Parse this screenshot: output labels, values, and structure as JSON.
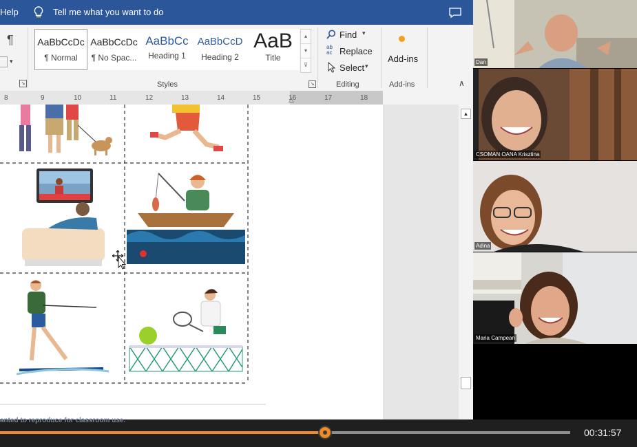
{
  "menu": {
    "help_label": "Help",
    "tell_me_placeholder": "Tell me what you want to do"
  },
  "ribbon": {
    "paragraph_mark": "¶",
    "styles": [
      {
        "sample": "AaBbCcDc",
        "name": "¶ Normal",
        "color": "#222222"
      },
      {
        "sample": "AaBbCcDc",
        "name": "¶ No Spac...",
        "color": "#222222"
      },
      {
        "sample": "AaBbCc",
        "name": "Heading 1",
        "color": "#2e5a9c"
      },
      {
        "sample": "AaBbCcD",
        "name": "Heading 2",
        "color": "#2e5a9c"
      },
      {
        "sample": "AaB",
        "name": "Title",
        "color": "#111111"
      }
    ],
    "styles_group_label": "Styles",
    "editing": {
      "find": "Find",
      "replace": "Replace",
      "select": "Select",
      "group_label": "Editing"
    },
    "addins": {
      "button_label": "Add-ins",
      "group_label": "Add-ins"
    }
  },
  "ruler": {
    "ticks": [
      "8",
      "9",
      "10",
      "11",
      "12",
      "13",
      "14",
      "15",
      "16",
      "17",
      "18"
    ]
  },
  "document": {
    "footer_text": "anted to reproduce for classroom use.",
    "pictures": [
      "family-walking-dog-illustration",
      "running-person-illustration",
      "watching-tv-illustration",
      "fishing-boat-illustration",
      "water-skiing-illustration",
      "tennis-player-illustration"
    ]
  },
  "participants": [
    {
      "name": "Dan"
    },
    {
      "name": "CSOMAN OANA Krisztina"
    },
    {
      "name": "Adina"
    },
    {
      "name": "Maria Campean"
    }
  ],
  "player": {
    "progress": 0.57,
    "time": "00:31:57"
  },
  "colors": {
    "word_blue": "#2b579a",
    "progress_orange": "#f08a23"
  }
}
